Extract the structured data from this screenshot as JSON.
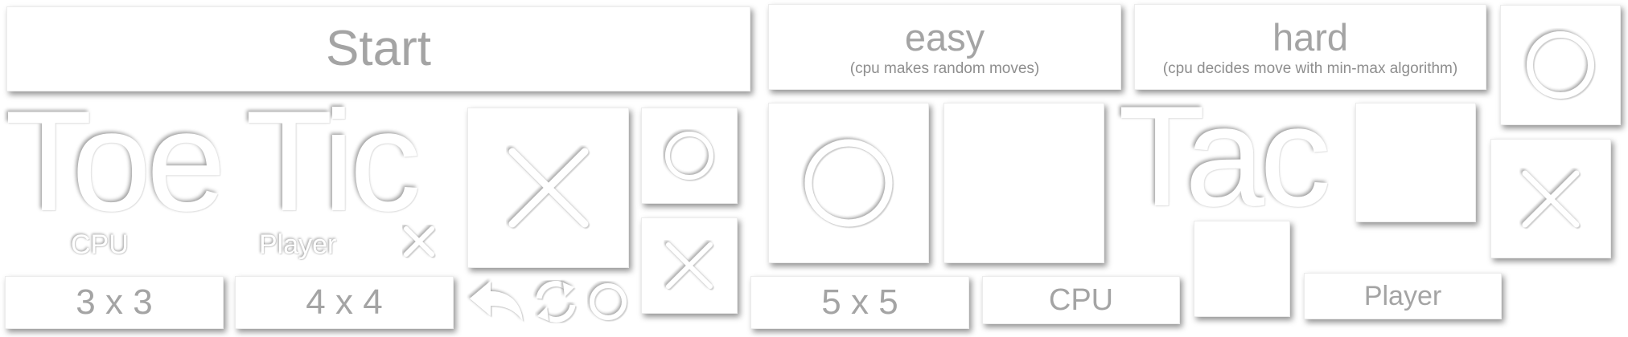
{
  "title_words": {
    "word1": "Toe",
    "word2": "Tic",
    "word3": "Tac"
  },
  "buttons": {
    "start": "Start",
    "easy": {
      "label": "easy",
      "description": "(cpu makes random moves)"
    },
    "hard": {
      "label": "hard",
      "description": "(cpu decides move with min-max algorithm)"
    },
    "size_3": "3 x 3",
    "size_4": "4 x 4",
    "size_5": "5 x 5",
    "cpu": "CPU",
    "player": "Player"
  },
  "embossed_labels": {
    "cpu": "CPU",
    "player": "Player"
  },
  "icons": {
    "undo": "undo-arrow-icon",
    "restart": "refresh-cycle-icon",
    "circle": "circle-mark-icon",
    "cross": "cross-mark-icon"
  },
  "tiles": [
    {
      "name": "large-x-tile",
      "mark": "X"
    },
    {
      "name": "small-o-tile",
      "mark": "O"
    },
    {
      "name": "small-x-tile",
      "mark": "X"
    },
    {
      "name": "large-o-tile",
      "mark": "O"
    },
    {
      "name": "empty-tile",
      "mark": ""
    },
    {
      "name": "empty-tile",
      "mark": ""
    },
    {
      "name": "empty-tile",
      "mark": ""
    },
    {
      "name": "corner-o-tile",
      "mark": "O"
    },
    {
      "name": "corner-x-tile",
      "mark": "X"
    }
  ],
  "colors": {
    "background": "#ffffff",
    "button_text": "#a4a4a4",
    "icon_cutout": "#ffffff",
    "shadow": "#777777"
  }
}
